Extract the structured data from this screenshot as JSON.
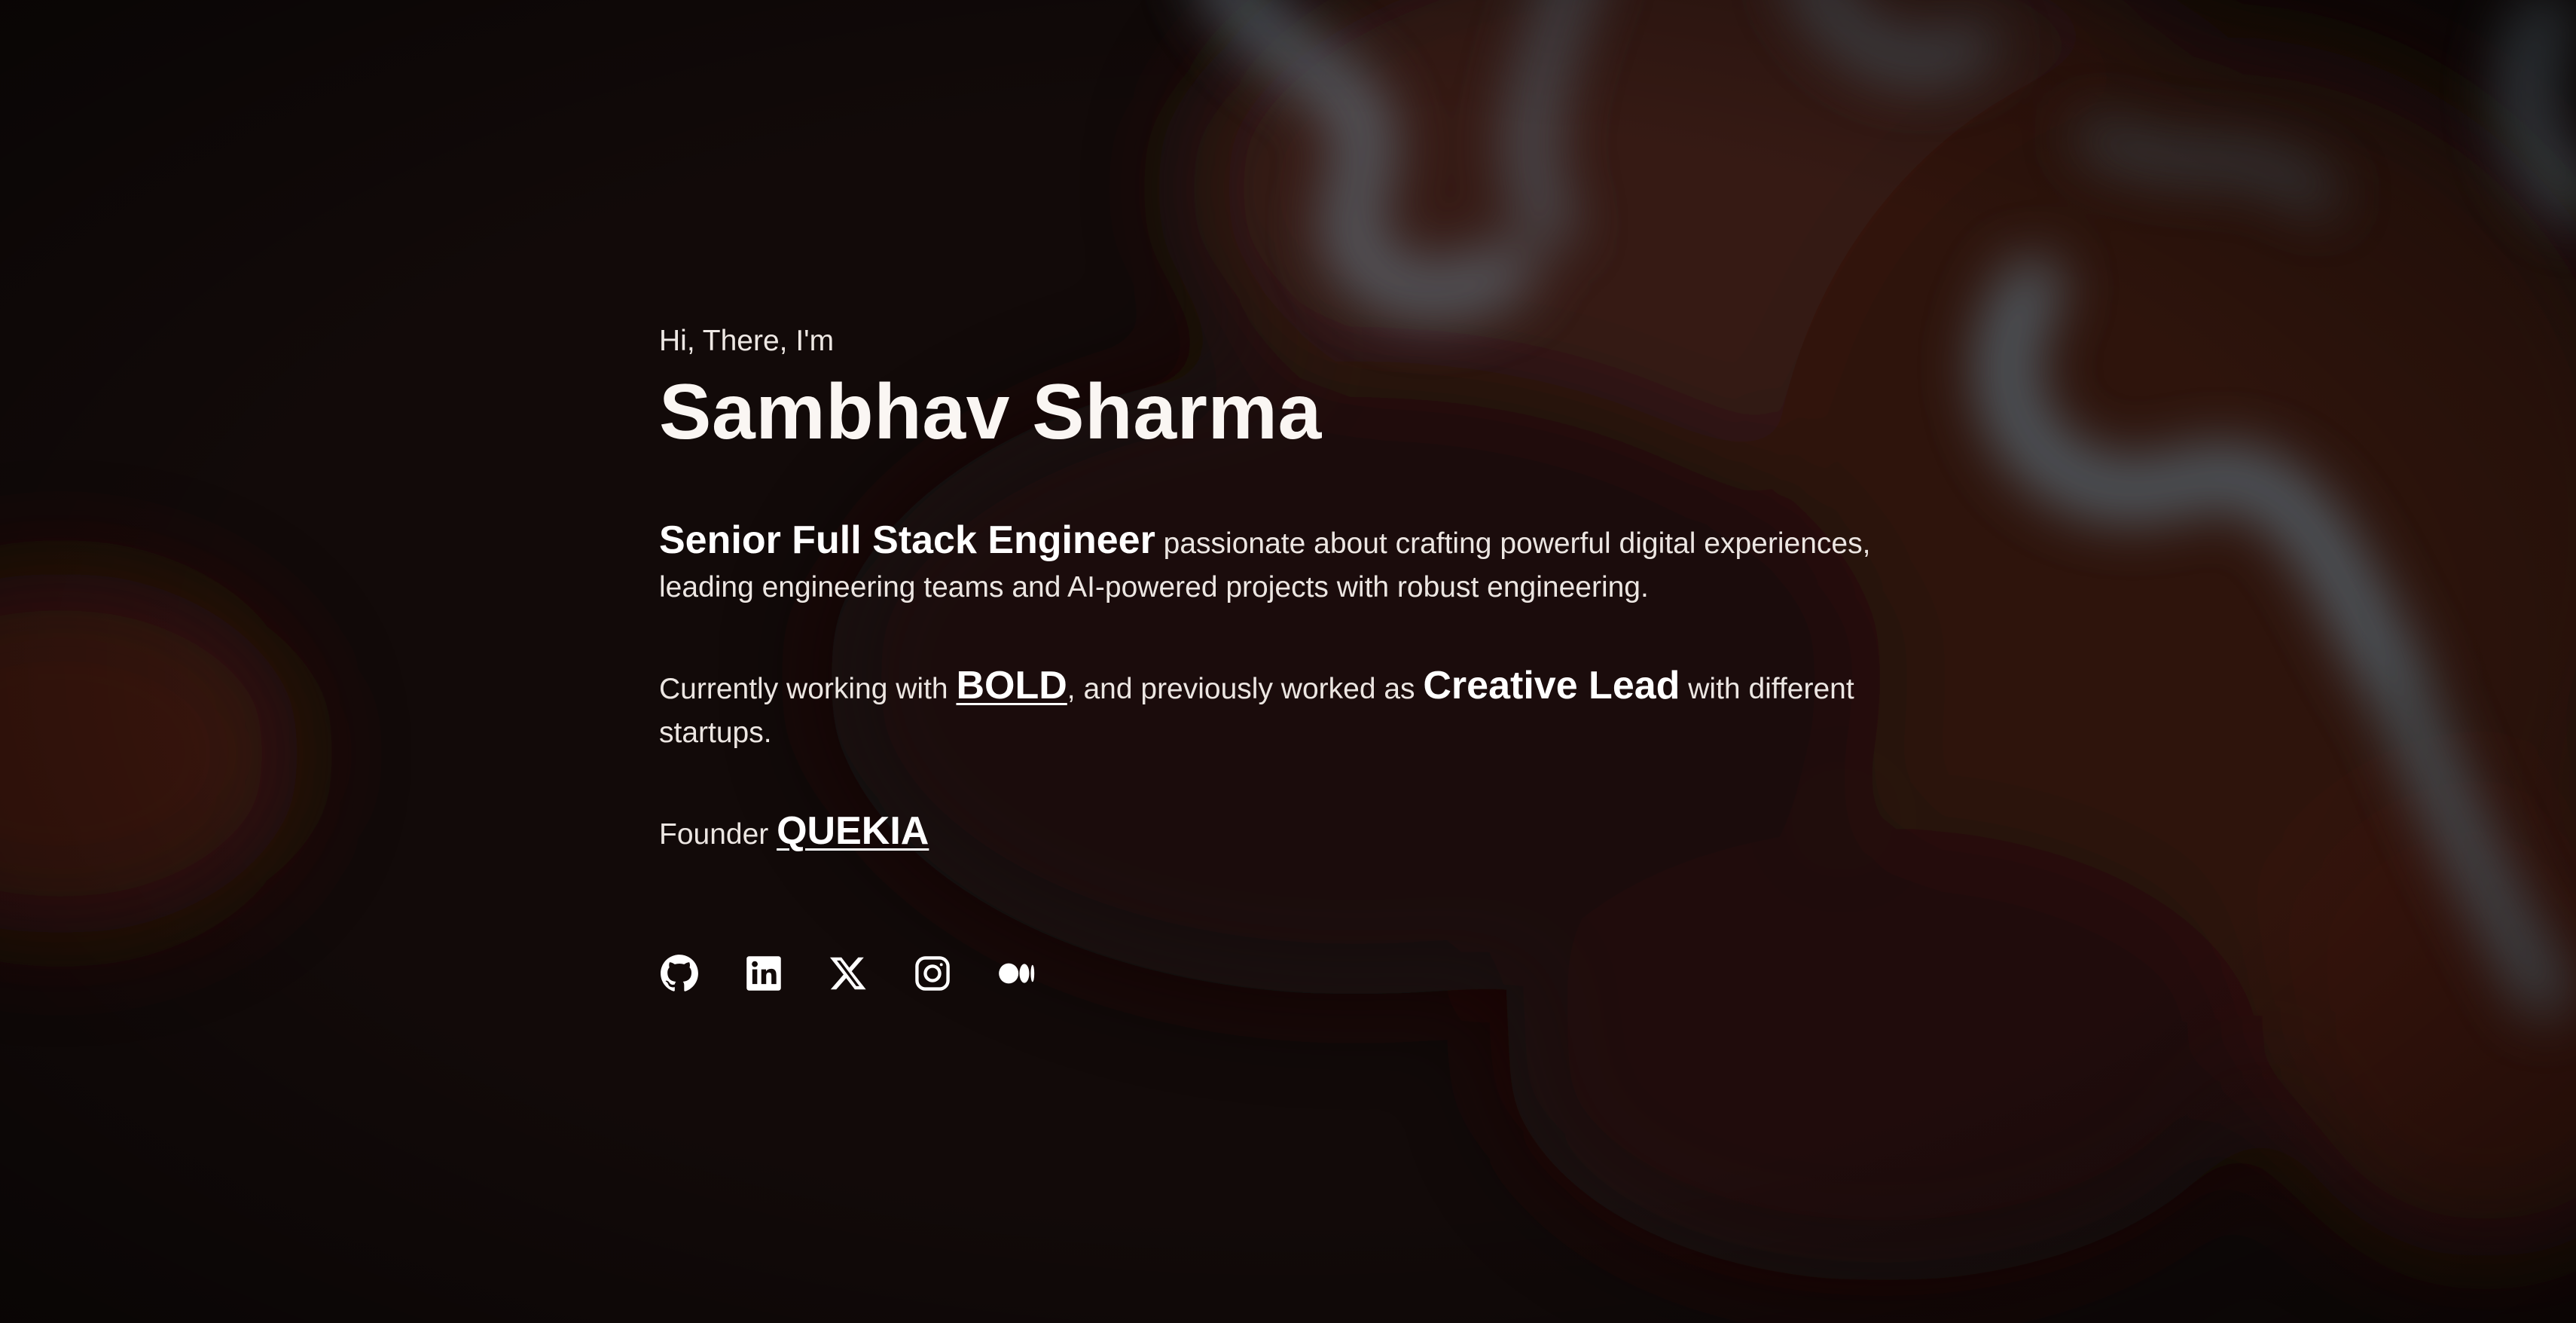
{
  "hero": {
    "greeting": "Hi, There, I'm",
    "name": "Sambhav Sharma"
  },
  "bio": {
    "role": "Senior Full Stack Engineer",
    "role_desc": " passionate about crafting powerful digital experiences, leading engineering teams and AI-powered projects with robust engineering."
  },
  "work": {
    "prefix": "Currently working with ",
    "company": "BOLD",
    "middle": ", and previously worked as ",
    "prev_role": "Creative Lead",
    "suffix": " with different startups."
  },
  "founder": {
    "prefix": "Founder ",
    "company": "QUEKIA"
  },
  "socials": [
    {
      "icon": "github-icon"
    },
    {
      "icon": "linkedin-icon"
    },
    {
      "icon": "x-icon"
    },
    {
      "icon": "instagram-icon"
    },
    {
      "icon": "medium-icon"
    }
  ],
  "colors": {
    "background": "#120a09",
    "text": "#f2ece8",
    "accent_glow_blue": "#5b6f7d",
    "accent_glow_red": "#5a2417"
  }
}
